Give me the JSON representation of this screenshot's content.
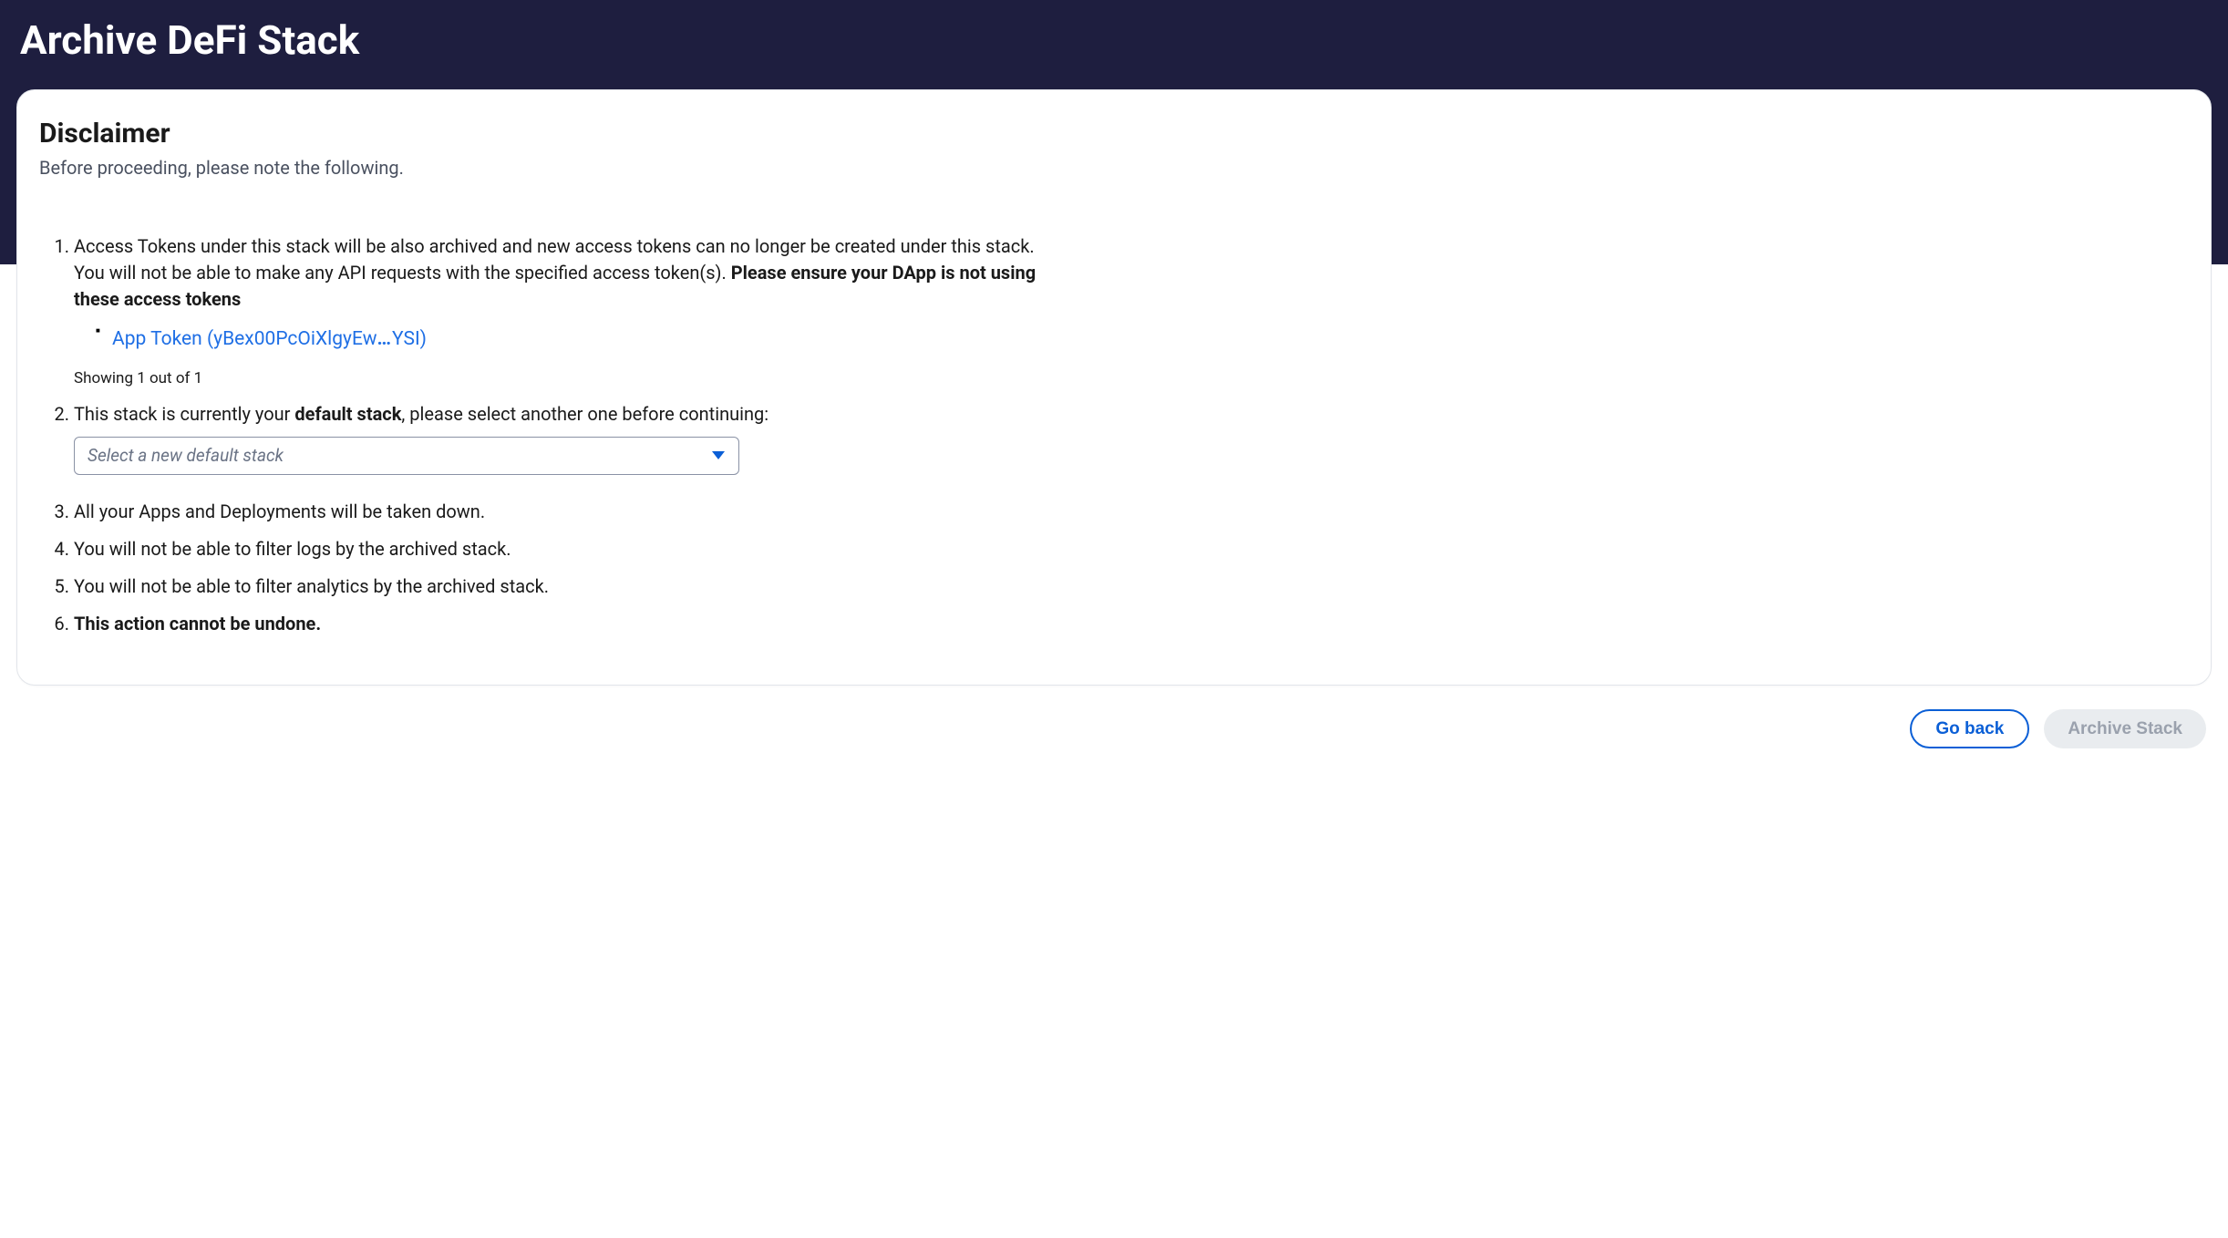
{
  "header": {
    "title": "Archive DeFi Stack"
  },
  "disclaimer": {
    "heading": "Disclaimer",
    "subheading": "Before proceeding, please note the following.",
    "item1": {
      "text_a": "Access Tokens under this stack will be also archived and new access tokens can no longer be created under this stack. You will not be able to make any API requests with the specified access token(s). ",
      "text_bold": "Please ensure your DApp is not using these access tokens",
      "tokens": [
        {
          "label_prefix": "App Token (yBex00PcOiXlgyEw",
          "label_ellipsis": "…",
          "label_suffix": "YSI)"
        }
      ],
      "showing": "Showing 1 out of 1"
    },
    "item2": {
      "text_a": "This stack is currently your ",
      "text_bold": "default stack",
      "text_b": ", please select another one before continuing:",
      "select_placeholder": "Select a new default stack"
    },
    "item3": "All your Apps and Deployments will be taken down.",
    "item4": "You will not be able to filter logs by the archived stack.",
    "item5": "You will not be able to filter analytics by the archived stack.",
    "item6_bold": "This action cannot be undone."
  },
  "actions": {
    "go_back": "Go back",
    "archive": "Archive Stack"
  },
  "colors": {
    "header_bg": "#1e1e3f",
    "link": "#1f6fe5",
    "primary": "#0b5fd6",
    "disabled_bg": "#e9ecef",
    "disabled_text": "#9aa1ad"
  }
}
